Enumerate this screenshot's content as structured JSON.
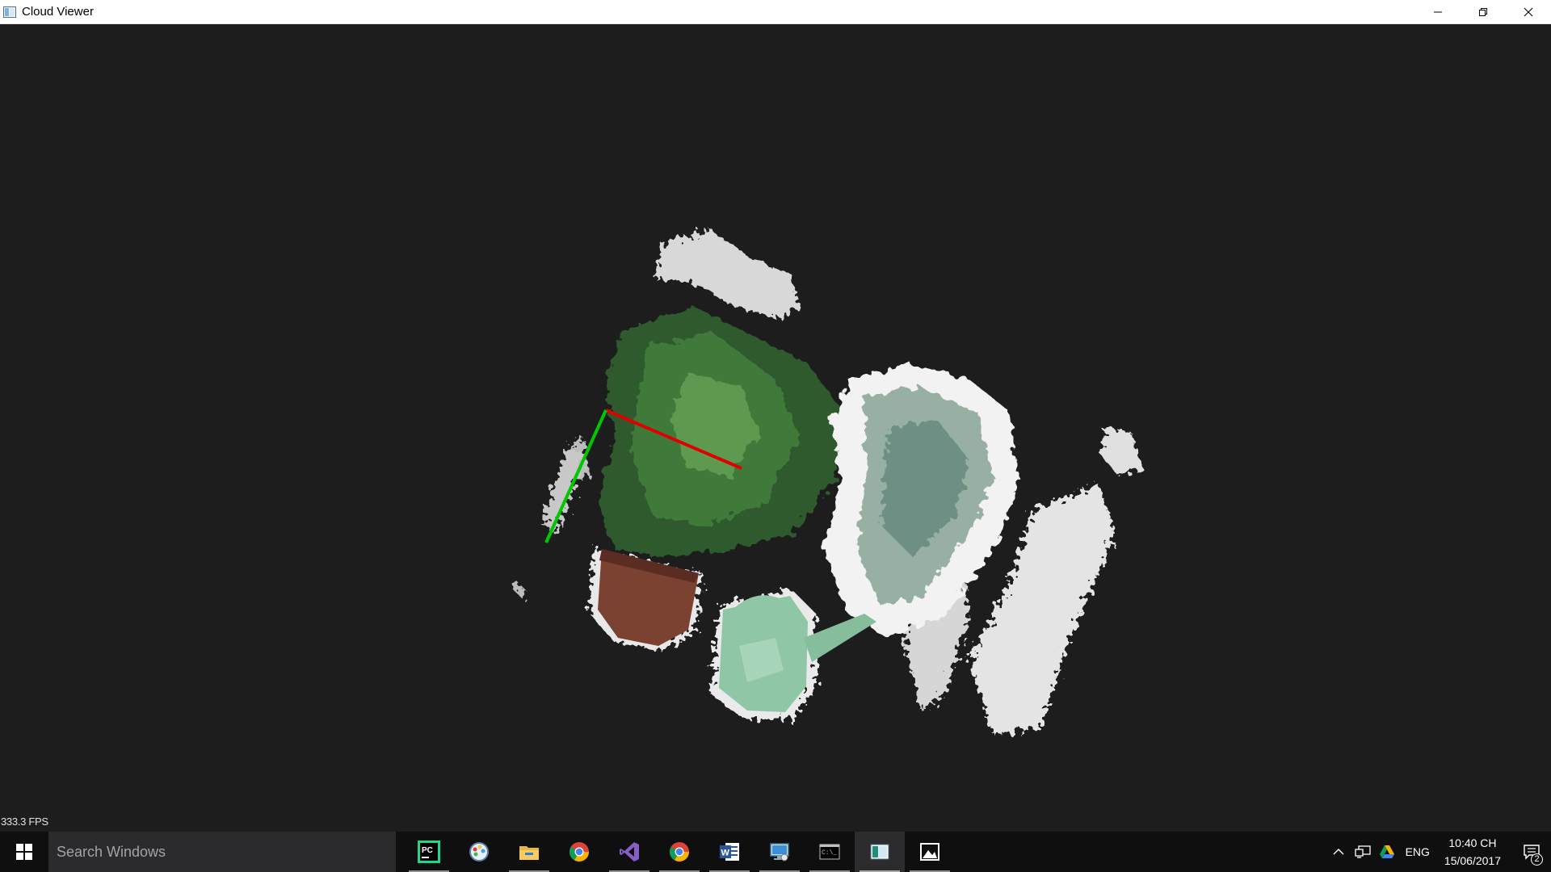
{
  "window": {
    "title": "Cloud Viewer",
    "controls": [
      "minimize",
      "restore",
      "close"
    ]
  },
  "viewport": {
    "fps_label": "333.3 FPS",
    "scene": "point-cloud-of-plants-and-watering-can",
    "axes": {
      "x_axis_color": "#e00000",
      "y_axis_color": "#00c800"
    }
  },
  "taskbar": {
    "search_placeholder": "Search Windows",
    "apps": [
      {
        "name": "pycharm-icon",
        "running": true
      },
      {
        "name": "paint-icon",
        "running": false
      },
      {
        "name": "file-explorer-icon",
        "running": true
      },
      {
        "name": "chrome-icon",
        "running": false
      },
      {
        "name": "visual-studio-icon",
        "running": true
      },
      {
        "name": "chrome-icon",
        "running": true
      },
      {
        "name": "word-icon",
        "running": true
      },
      {
        "name": "remote-desktop-icon",
        "running": true
      },
      {
        "name": "command-prompt-icon",
        "running": true
      },
      {
        "name": "cloud-viewer-icon",
        "running": true,
        "active": true
      },
      {
        "name": "photos-icon",
        "running": true
      }
    ],
    "tray": {
      "language": "ENG",
      "time": "10:40 CH",
      "date": "15/06/2017",
      "notification_count": "2"
    }
  }
}
